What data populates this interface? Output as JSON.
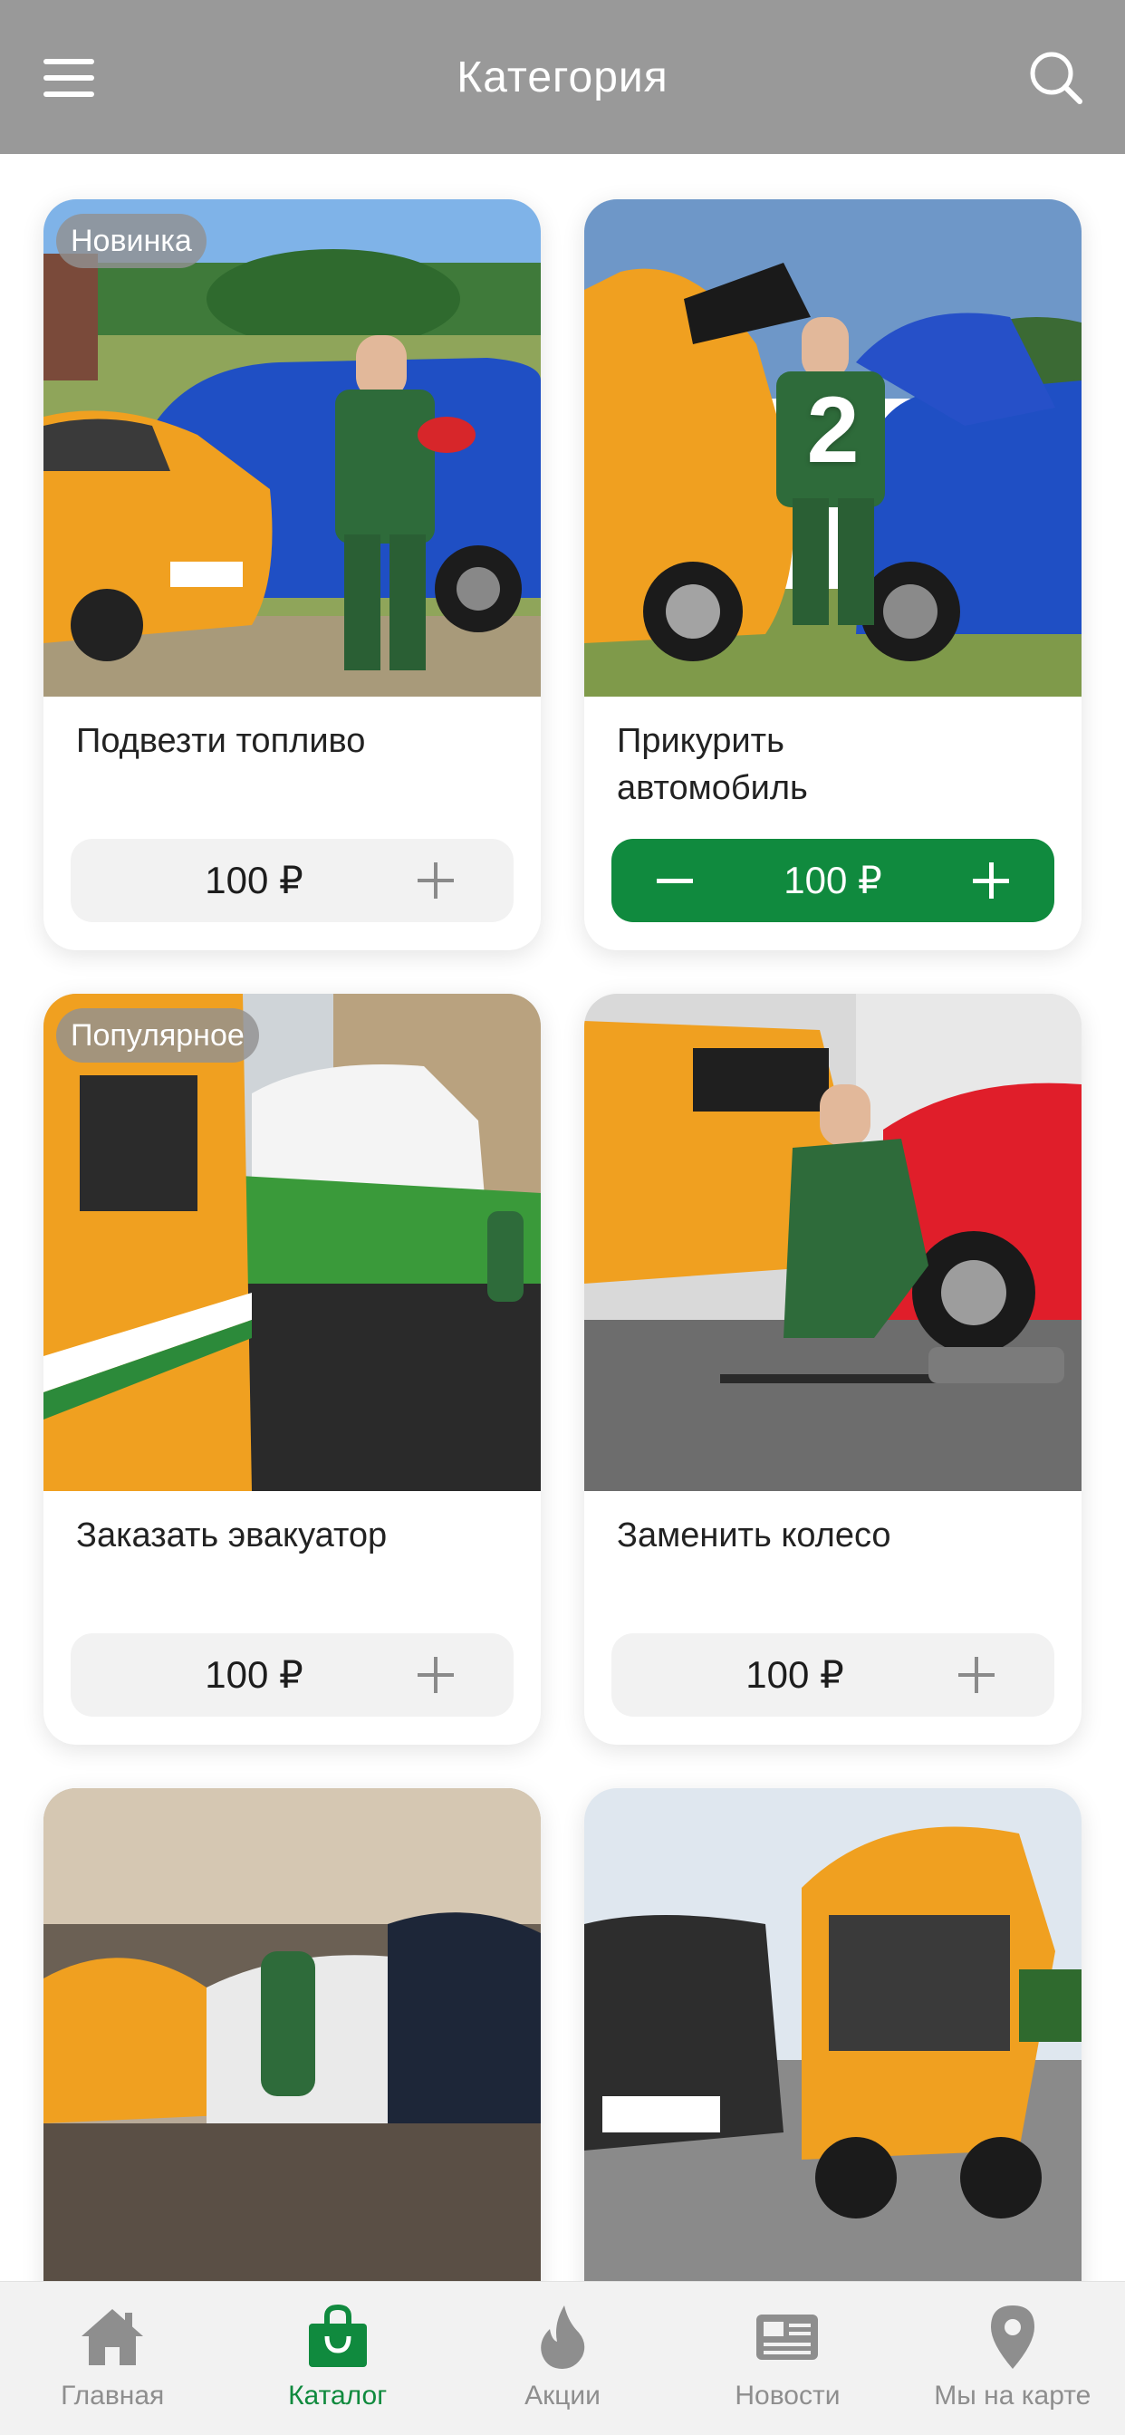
{
  "header": {
    "title": "Категория",
    "background": "#999999"
  },
  "products": [
    {
      "title": "Подвезти топливо",
      "badge": "Новинка",
      "price": "100 ₽",
      "in_cart": false
    },
    {
      "title": "Прикурить автомобиль",
      "badge": "",
      "quantity": "2",
      "price": "100 ₽",
      "in_cart": true
    },
    {
      "title": "Заказать эвакуатор",
      "badge": "Популярное",
      "price": "100 ₽",
      "in_cart": false
    },
    {
      "title": "Заменить колесо",
      "badge": "",
      "price": "100 ₽",
      "in_cart": false
    },
    {
      "title": "",
      "badge": "",
      "price": "",
      "in_cart": false
    },
    {
      "title": "",
      "badge": "",
      "price": "",
      "in_cart": false
    }
  ],
  "tabs": [
    {
      "label": "Главная",
      "icon": "home-icon",
      "active": false
    },
    {
      "label": "Каталог",
      "icon": "shopping-bag-icon",
      "active": true
    },
    {
      "label": "Акции",
      "icon": "flame-icon",
      "active": false
    },
    {
      "label": "Новости",
      "icon": "newspaper-icon",
      "active": false
    },
    {
      "label": "Мы на карте",
      "icon": "map-pin-icon",
      "active": false
    }
  ],
  "colors": {
    "accent": "#108a3e",
    "tab_inactive": "#8e8e8e",
    "header": "#999999",
    "brand_orange": "#f0a020"
  }
}
